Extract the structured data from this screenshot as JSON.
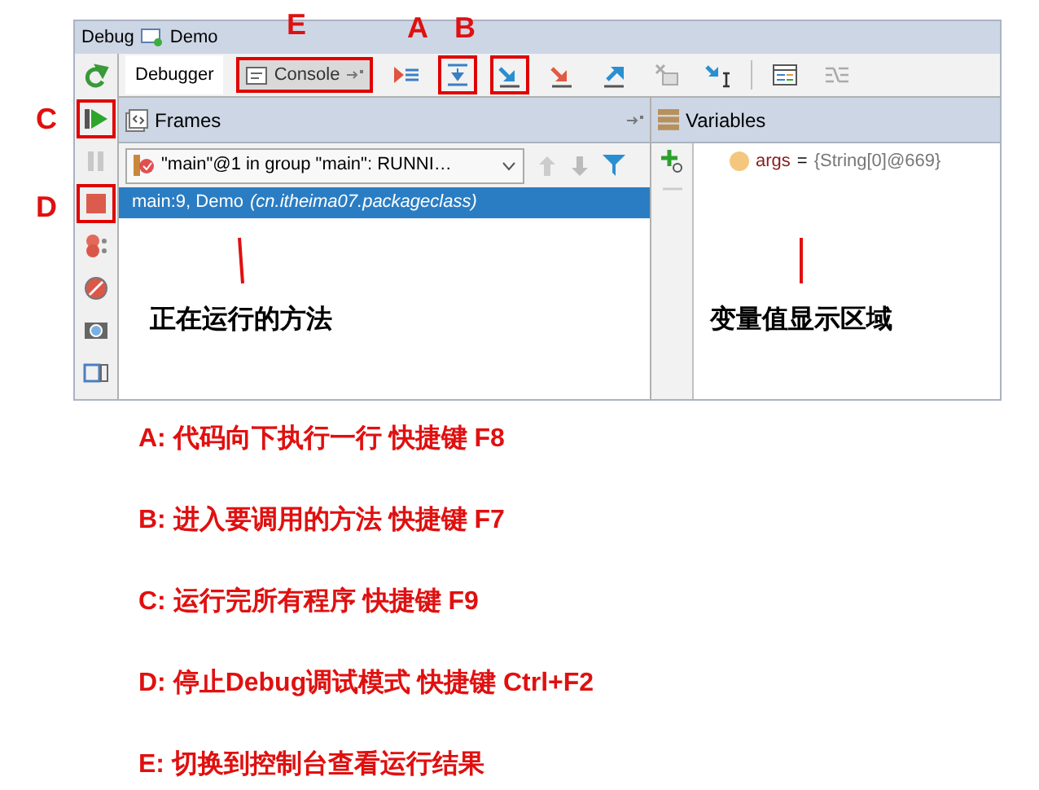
{
  "window": {
    "title": "Debug",
    "config": "Demo"
  },
  "tabs": [
    {
      "label": "Debugger",
      "selected": true,
      "highlighted": false
    },
    {
      "label": "Console",
      "selected": false,
      "highlighted": true
    }
  ],
  "debug_toolbar": [
    {
      "kind": "show-execution-point",
      "highlighted": false
    },
    {
      "kind": "step-over",
      "highlighted": true
    },
    {
      "kind": "step-into",
      "highlighted": true
    },
    {
      "kind": "force-step-into",
      "highlighted": false
    },
    {
      "kind": "step-out",
      "highlighted": false
    },
    {
      "kind": "drop-frame",
      "highlighted": false
    },
    {
      "kind": "run-to-cursor",
      "highlighted": false
    },
    {
      "kind": "separator"
    },
    {
      "kind": "evaluate",
      "highlighted": false
    },
    {
      "kind": "trace",
      "highlighted": false
    }
  ],
  "left_toolbar": [
    {
      "kind": "rerun",
      "highlighted": false
    },
    {
      "kind": "resume",
      "highlighted": true
    },
    {
      "kind": "pause",
      "highlighted": false
    },
    {
      "kind": "stop",
      "highlighted": true
    },
    {
      "kind": "breakpoints",
      "highlighted": false
    },
    {
      "kind": "mute",
      "highlighted": false
    },
    {
      "kind": "camera",
      "highlighted": false
    },
    {
      "kind": "layout",
      "highlighted": false
    }
  ],
  "frames": {
    "title": "Frames",
    "thread": "\"main\"@1 in group \"main\": RUNNI…",
    "items": [
      {
        "label": "main:9, Demo",
        "package": "(cn.itheima07.packageclass)",
        "selected": true
      }
    ]
  },
  "variables": {
    "title": "Variables",
    "items": [
      {
        "name": "args",
        "sign": "=",
        "value": "{String[0]@669}"
      }
    ]
  },
  "markers": [
    "E",
    "A",
    "B",
    "C",
    "D"
  ],
  "callouts": [
    "正在运行的方法",
    "变量值显示区域"
  ],
  "notes": [
    "A: 代码向下执行一行 快捷键 F8",
    "B: 进入要调用的方法 快捷键 F7",
    "C: 运行完所有程序 快捷键 F9",
    "D: 停止Debug调试模式 快捷键 Ctrl+F2",
    "E: 切换到控制台查看运行结果"
  ]
}
